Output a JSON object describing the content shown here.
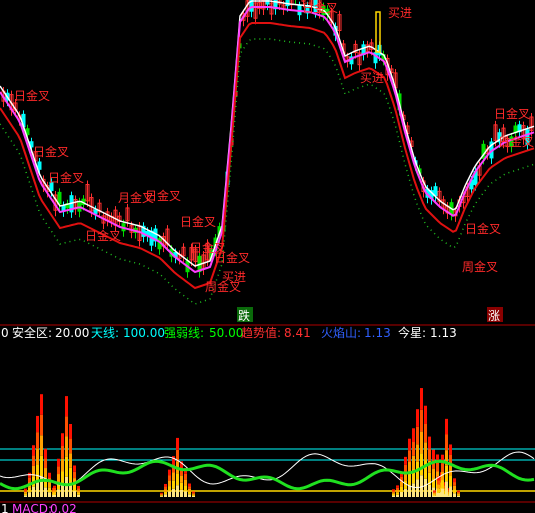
{
  "top_panel": {
    "signals": [
      {
        "text": "日金叉"
      },
      {
        "text": "周金叉"
      },
      {
        "text": "月金叉"
      },
      {
        "text": "买进"
      },
      {
        "text": "跌"
      },
      {
        "text": "涨"
      }
    ]
  },
  "indicator_bar": {
    "prefix": "0",
    "items": [
      {
        "label": "安全区:",
        "value": "20.00",
        "color": "#ffffff"
      },
      {
        "label": "天线:",
        "value": "100.00",
        "color": "#00ffff"
      },
      {
        "label": "强弱线:",
        "value": "50.00",
        "color": "#00ff00"
      },
      {
        "label": "趋势值:",
        "value": "8.41",
        "color": "#ff3030"
      },
      {
        "label": "火焰山:",
        "value": "1.13",
        "color": "#3060ff"
      },
      {
        "label": "今星:",
        "value": "1.13",
        "color": "#ffffff"
      }
    ]
  },
  "bottom_bar": {
    "prefix": "1",
    "label": "MACD:",
    "value": "0.02",
    "color": "#ff40ff"
  },
  "colors": {
    "up": "#ff3030",
    "down": "#00ffff",
    "ma_white": "#ffffff",
    "ma_magenta": "#ff40ff",
    "ma_red": "#e01010",
    "dots_green": "#20c020",
    "flame_yellow": "#ffd800",
    "flame_red": "#ff2000"
  }
}
